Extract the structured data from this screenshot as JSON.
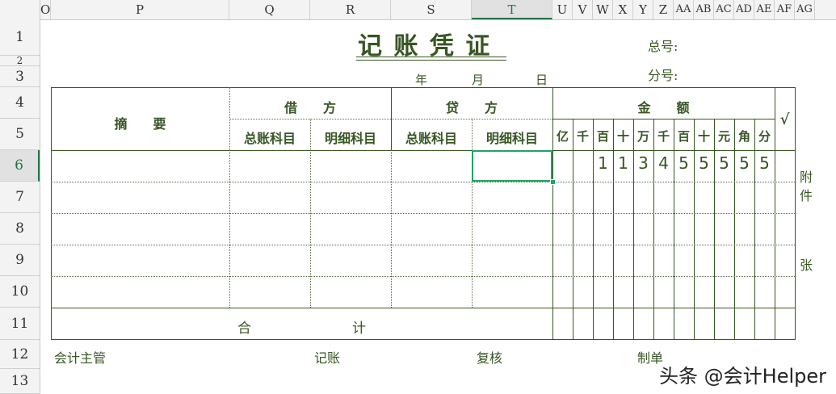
{
  "spreadsheet": {
    "columns": [
      "O",
      "P",
      "Q",
      "R",
      "S",
      "T",
      "U",
      "V",
      "W",
      "X",
      "Y",
      "Z",
      "AA",
      "AB",
      "AC",
      "AD",
      "AE",
      "AF",
      "AG"
    ],
    "selected_column": "T",
    "rows": [
      "1",
      "2",
      "3",
      "4",
      "5",
      "6",
      "7",
      "8",
      "9",
      "10",
      "11",
      "12",
      "13"
    ],
    "selected_row": "6"
  },
  "voucher": {
    "title": "记 账 凭 证",
    "total_no_label": "总号:",
    "sub_no_label": "分号:",
    "date_year": "年",
    "date_month": "月",
    "date_day": "日",
    "summary_label": "摘　　要",
    "debit_label": "借　　方",
    "credit_label": "贷　　方",
    "amount_label": "金　　额",
    "check_mark": "√",
    "debit_general": "总账科目",
    "debit_detail": "明细科目",
    "credit_general": "总账科目",
    "credit_detail": "明细科目",
    "units": [
      "亿",
      "千",
      "百",
      "十",
      "万",
      "千",
      "百",
      "十",
      "元",
      "角",
      "分"
    ],
    "amount_digits": [
      "",
      "",
      "1",
      "1",
      "3",
      "4",
      "5",
      "5",
      "5",
      "5",
      "5"
    ],
    "attach_label_1": "附",
    "attach_label_2": "件",
    "attach_label_3": "张",
    "total_label_1": "合",
    "total_label_2": "计",
    "footer_supervisor": "会计主管",
    "footer_bookkeeper": "记账",
    "footer_reviewer": "复核",
    "footer_preparer": "制单"
  },
  "watermark": "头条 @会计Helper",
  "colors": {
    "accent": "#217346",
    "ink": "#375623",
    "selection": "#21a366"
  }
}
